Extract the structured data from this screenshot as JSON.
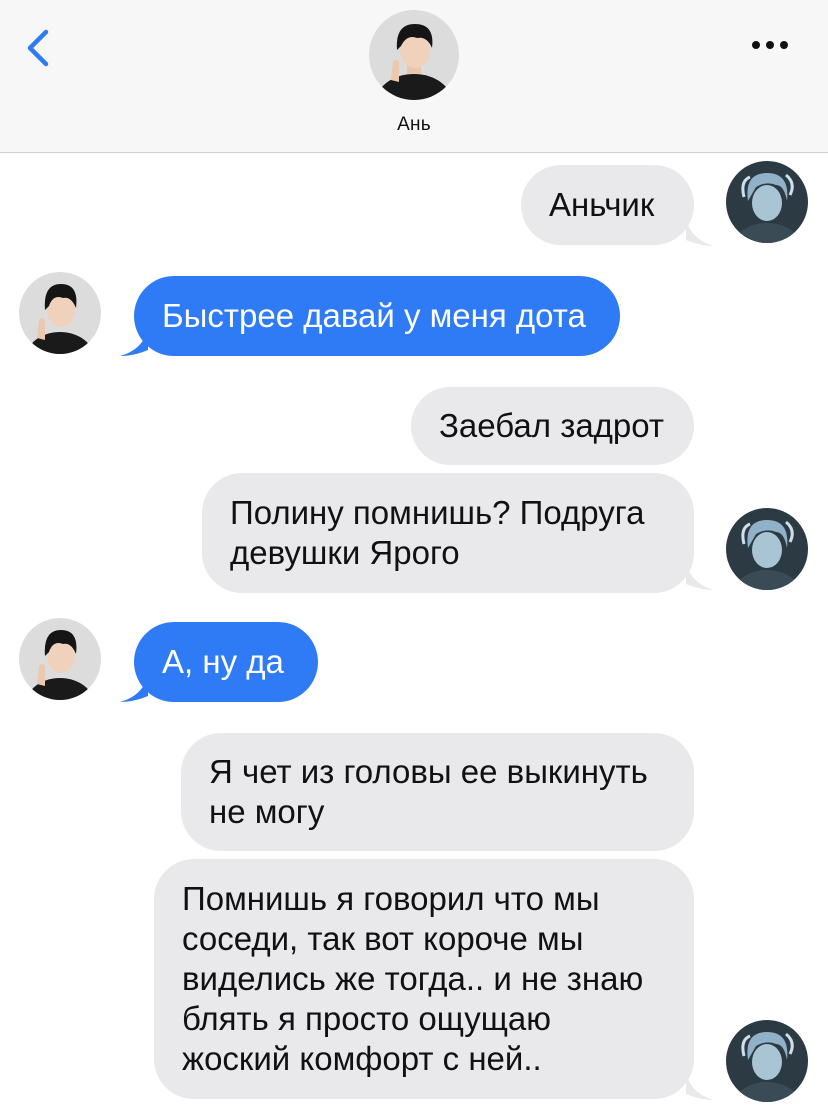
{
  "header": {
    "contact_name": "Ань",
    "back_icon": "chevron-left-icon",
    "more_icon": "ellipsis-icon"
  },
  "colors": {
    "accent": "#2f7bf6",
    "incoming_bubble": "#e9e9eb",
    "outgoing_bubble": "#2f7bf6",
    "header_bg": "#f7f7f7"
  },
  "messages": [
    {
      "sender": "me",
      "text": "Аньчик"
    },
    {
      "sender": "contact",
      "text": "Быстрее давай у меня дота"
    },
    {
      "sender": "me",
      "text": "Заебал задрот"
    },
    {
      "sender": "me",
      "lines": [
        "Полину помнишь? Подруга",
        "девушки Ярого"
      ]
    },
    {
      "sender": "contact",
      "text": "А, ну да"
    },
    {
      "sender": "me",
      "lines": [
        "Я чет из головы ее выкинуть",
        "не могу"
      ]
    },
    {
      "sender": "me",
      "lines": [
        "Помнишь я говорил что мы",
        "соседи, так вот короче мы",
        "виделись же тогда.. и не знаю",
        "блять я просто ощущаю",
        "жоский комфорт с ней.."
      ]
    }
  ]
}
